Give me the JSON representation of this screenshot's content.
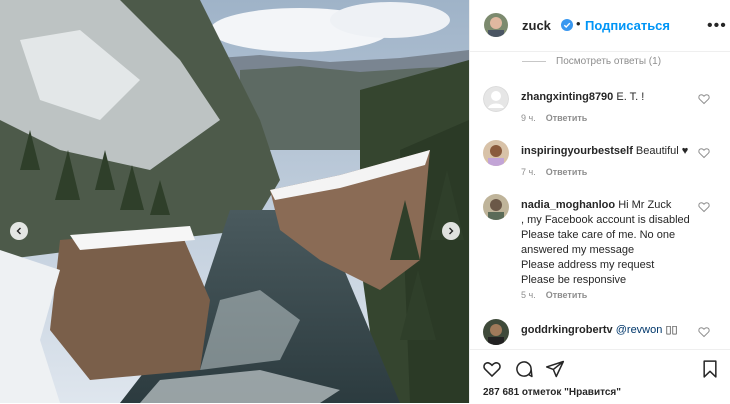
{
  "post": {
    "username": "zuck",
    "follow_label": "Подписаться",
    "dot": "•",
    "more_label": "•••",
    "view_replies_label": "Посмотреть ответы (1)",
    "likes_text": "287 681 отметок \"Нравится\""
  },
  "comments": [
    {
      "user": "zhangxinting8790",
      "text": "E. T. !",
      "time": "9 ч.",
      "reply": "Ответить"
    },
    {
      "user": "inspiringyourbestself",
      "text": "Beautiful ♥",
      "time": "7 ч.",
      "reply": "Ответить"
    },
    {
      "user": "nadia_moghanloo",
      "text": "Hi Mr Zuck\n, my Facebook account is disabled\nPlease take care of me. No one answered my message\nPlease address my request\nPlease be responsive",
      "time": "5 ч.",
      "reply": "Ответить"
    },
    {
      "user": "goddrkingrobertv",
      "mention": "@revwon",
      "text": "▯▯"
    }
  ],
  "colors": {
    "accent": "#0095f6",
    "verified": "#3897f0",
    "muted": "#8e8e8e"
  },
  "icons": [
    "verified-badge-icon",
    "more-options-icon",
    "heart-icon",
    "comment-icon",
    "share-icon",
    "bookmark-icon",
    "chevron-left-icon",
    "chevron-right-icon"
  ]
}
